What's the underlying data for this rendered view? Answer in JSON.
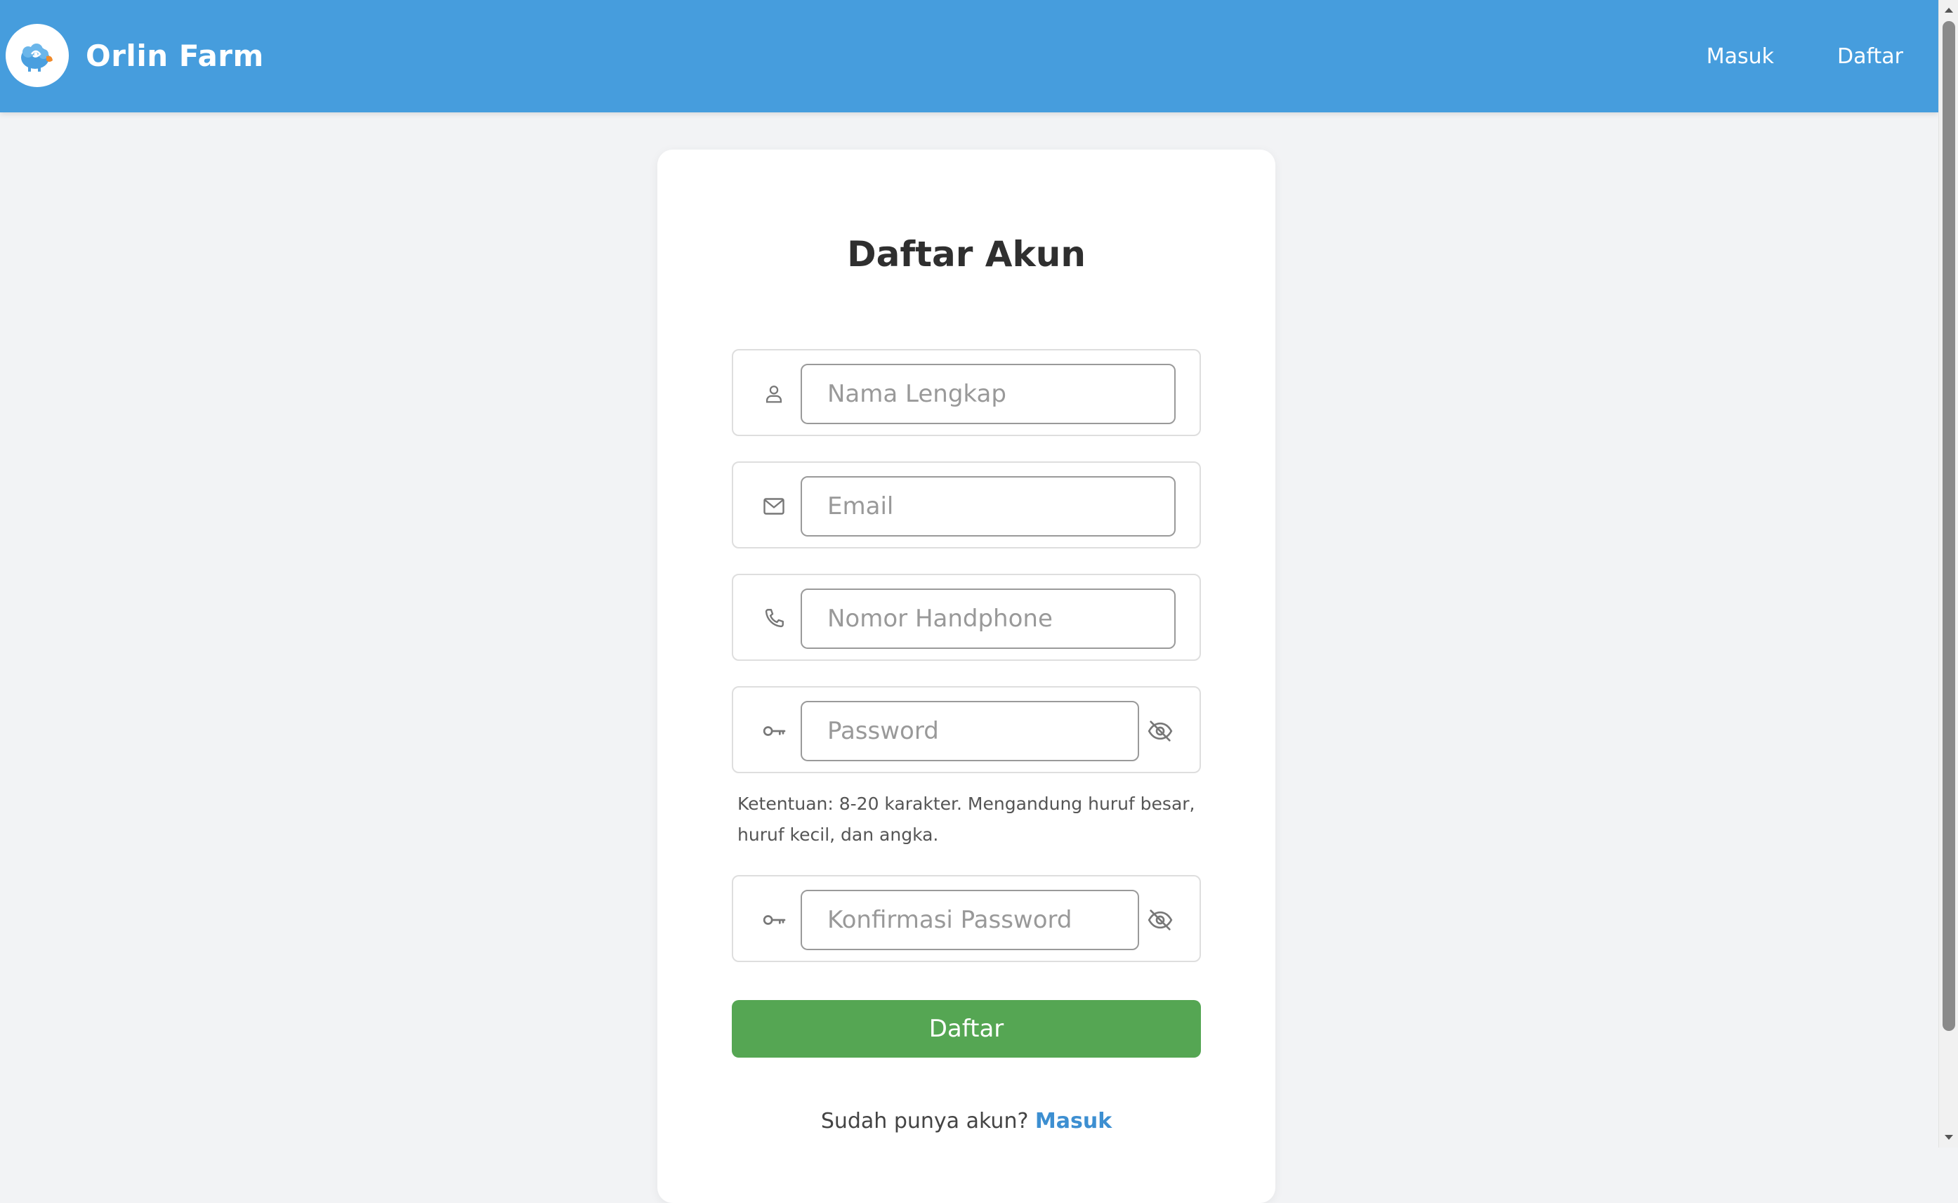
{
  "header": {
    "brand_name": "Orlin Farm",
    "logo_icon": "sheep-logo",
    "nav": {
      "login_label": "Masuk",
      "register_label": "Daftar"
    },
    "background_color": "#469ddd"
  },
  "form": {
    "title": "Daftar Akun",
    "fields": {
      "name": {
        "icon": "user-icon",
        "placeholder": "Nama Lengkap",
        "value": ""
      },
      "email": {
        "icon": "mail-icon",
        "placeholder": "Email",
        "value": ""
      },
      "phone": {
        "icon": "phone-icon",
        "placeholder": "Nomor Handphone",
        "value": ""
      },
      "password": {
        "icon": "key-icon",
        "placeholder": "Password",
        "value": "",
        "toggle_icon": "eye-off-icon"
      },
      "confirm_password": {
        "icon": "key-icon",
        "placeholder": "Konfirmasi Password",
        "value": "",
        "toggle_icon": "eye-off-icon"
      }
    },
    "password_hint": "Ketentuan: 8-20 karakter. Mengandung huruf besar, huruf kecil, dan angka.",
    "submit_label": "Daftar",
    "submit_color": "#55a653",
    "login_prompt": "Sudah punya akun?",
    "login_link_label": "Masuk",
    "link_color": "#3d8fd1"
  }
}
